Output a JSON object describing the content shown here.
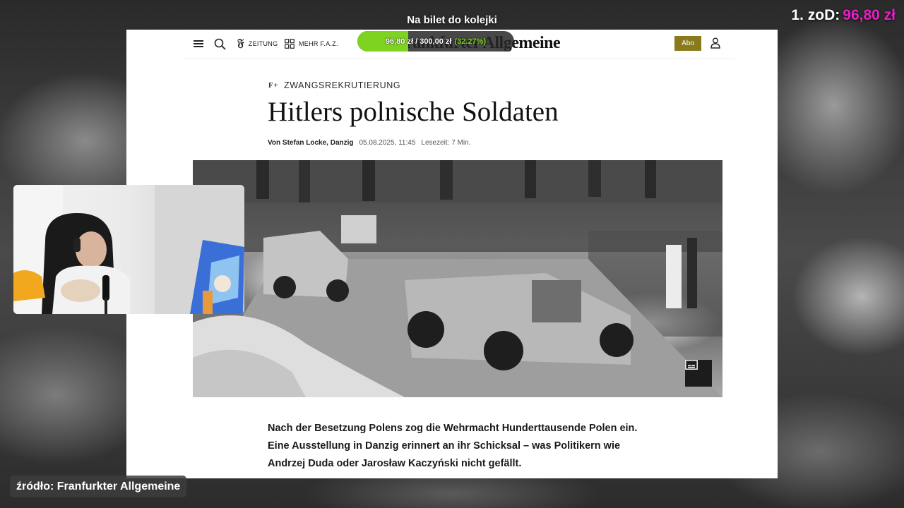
{
  "overlay": {
    "goal_title": "Na bilet do kolejki",
    "top_donor_label": "1. zoD:",
    "top_donor_amount": "96,80 zł",
    "progress_text": "96,80 zł / 300,00 zł",
    "progress_percent": "(32.27%)",
    "progress_fraction": 0.3227,
    "source_label": "źródło: Franfurkter Allgemeine"
  },
  "nav": {
    "zeitung_label": "ZEITUNG",
    "mehr_label": "MEHR F.A.Z.",
    "logo_text": "Frankfurter Allgemeine",
    "abo_label": "Abo"
  },
  "article": {
    "kicker": "ZWANGSREKRUTIERUNG",
    "headline": "Hitlers polnische Soldaten",
    "author": "Von Stefan Locke, Danzig",
    "date": "05.08.2025, 11:45",
    "reading_time": "Lesezeit: 7 Min.",
    "lead_lines": [
      "Nach der Besetzung Polens zog die Wehrmacht Hunderttausende Polen ein.",
      "Eine Ausstellung in Danzig erinnert an ihr Schicksal – was Politikern wie",
      "Andrzej Duda oder Jarosław Kaczyński nicht gefällt."
    ]
  },
  "colors": {
    "abo_bg": "#8a7a1e",
    "progress_fill": "#7ed321",
    "donor_amount": "#e81ec8"
  },
  "icons": {
    "menu": "hamburger-icon",
    "search": "search-icon",
    "zeitung": "faz-f-logo-icon",
    "mehr": "grid-icon",
    "account": "user-icon",
    "caption": "subtitles-icon"
  }
}
